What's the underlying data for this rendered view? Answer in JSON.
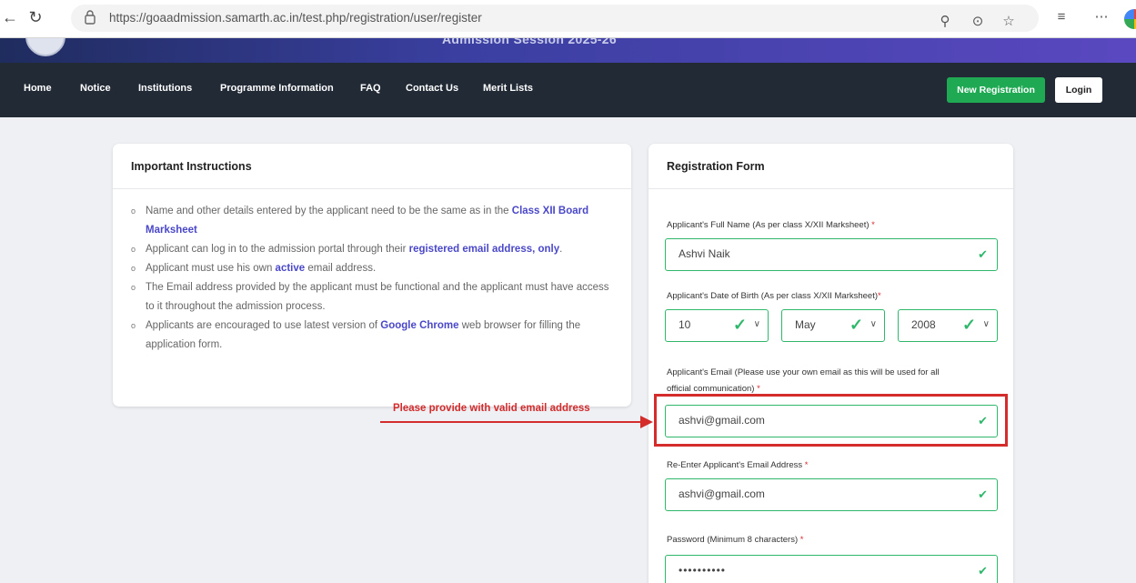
{
  "browser": {
    "url": "https://goaadmission.samarth.ac.in/test.php/registration/user/register",
    "icons": [
      "back-arrow-icon",
      "refresh-icon",
      "lock-icon",
      "zoom-icon",
      "reader-icon",
      "favorite-star-icon",
      "collections-icon",
      "more-icon",
      "profile-icon"
    ]
  },
  "header": {
    "session_text": "Admission Session 2025-26"
  },
  "nav": {
    "items": [
      "Home",
      "Notice",
      "Institutions",
      "Programme Information",
      "FAQ",
      "Contact Us",
      "Merit Lists"
    ],
    "new_registration": "New Registration",
    "login": "Login"
  },
  "instructions": {
    "title": "Important Instructions",
    "items": [
      {
        "pre": "Name and other details entered by the applicant need to be the same as in the ",
        "hl": "Class XII Board Marksheet",
        "post": ""
      },
      {
        "pre": "Applicant can log in to the admission portal through their ",
        "hl": "registered email address, only",
        "post": "."
      },
      {
        "pre": "Applicant must use his own ",
        "hl": "active",
        "post": " email address."
      },
      {
        "pre": "The Email address provided by the applicant must be functional and the applicant must have access to it throughout the admission process.",
        "hl": "",
        "post": ""
      },
      {
        "pre": "Applicants are encouraged to use latest version of ",
        "hl": "Google Chrome",
        "post": " web browser for filling the application form."
      }
    ]
  },
  "form": {
    "title": "Registration Form",
    "full_name_label": "Applicant's Full Name (As per class X/XII Marksheet)",
    "full_name_value": "Ashvi Naik",
    "dob_label": "Applicant's Date of Birth (As per class X/XII Marksheet)",
    "dob_day": "10",
    "dob_month": "May",
    "dob_year": "2008",
    "email_label_line1": "Applicant's Email (Please use your own email as this will be used for all",
    "email_label_line2": "official communication)",
    "email_value": "ashvi@gmail.com",
    "reenter_label": "Re-Enter Applicant's Email Address",
    "reenter_value": "ashvi@gmail.com",
    "password_label": "Password (Minimum 8 characters)",
    "password_value": "••••••••••",
    "required_mark": "*"
  },
  "annotation": {
    "text": "Please provide with valid email address",
    "color": "#d42b2b"
  },
  "colors": {
    "nav_bg": "#222a36",
    "accent_green": "#1ea952",
    "field_border": "#2fb86b",
    "highlight": "#4a48c8"
  }
}
